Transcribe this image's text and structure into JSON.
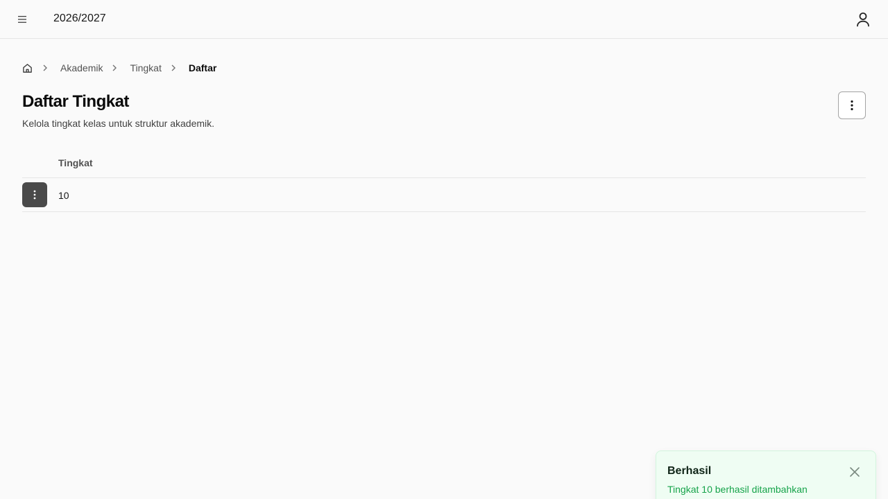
{
  "header": {
    "academic_year": "2026/2027",
    "menu_icon": "hamburger-icon",
    "user_icon": "user-icon"
  },
  "breadcrumb": {
    "home_icon": "home-icon",
    "items": [
      "Akademik",
      "Tingkat",
      "Daftar"
    ]
  },
  "page": {
    "title": "Daftar Tingkat",
    "description": "Kelola tingkat kelas untuk struktur akademik."
  },
  "table": {
    "columns": [
      "Tingkat"
    ],
    "rows": [
      {
        "tingkat": "10"
      }
    ]
  },
  "toast": {
    "title": "Berhasil",
    "message": "Tingkat 10 berhasil ditambahkan",
    "status_color": "#16a34a"
  }
}
